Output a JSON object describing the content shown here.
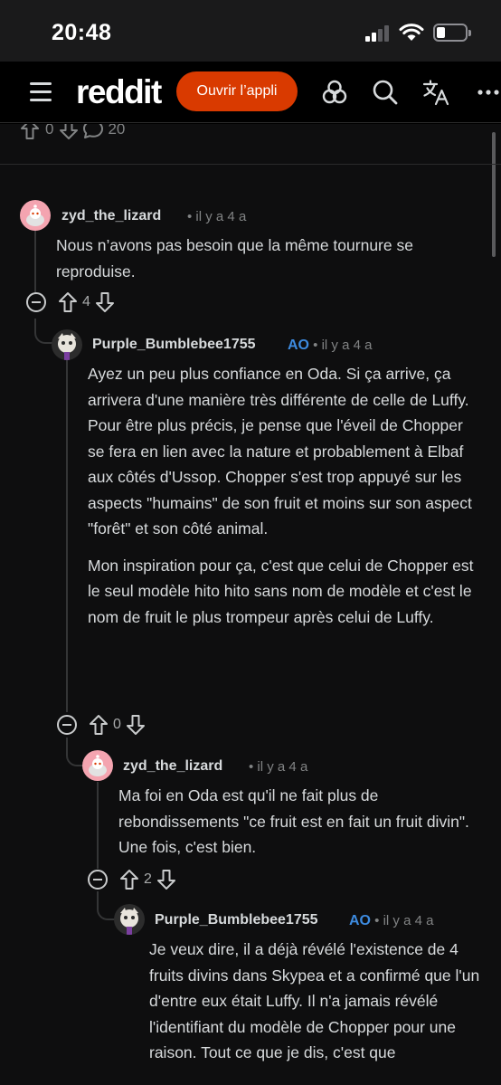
{
  "status": {
    "time": "20:48"
  },
  "header": {
    "logo": "reddit",
    "open_app_label": "Ouvrir l’appli"
  },
  "post_bar": {
    "up_count": "0",
    "comment_count": "20"
  },
  "comments": [
    {
      "author": "zyd_the_lizard",
      "op": "",
      "age": "• il y a 4 a",
      "paragraphs": [
        "Nous n’avons pas besoin que la même tournure se reproduise."
      ],
      "score": "4"
    },
    {
      "author": "Purple_Bumblebee1755",
      "op": "AO",
      "age": "• il y a 4 a",
      "paragraphs": [
        "Ayez un peu plus confiance en Oda. Si ça arrive, ça arrivera d'une manière très différente de celle de Luffy. Pour être plus précis, je pense que l'éveil de Chopper se fera en lien avec la nature et probablement à Elbaf aux côtés d'Ussop. Chopper s'est trop appuyé sur les aspects \"humains\" de son fruit et moins sur son aspect \"forêt\" et son côté animal.",
        "Mon inspiration pour ça, c'est que celui de Chopper est le seul modèle hito hito sans nom de modèle et c'est le nom de fruit le plus trompeur après celui de Luffy."
      ],
      "score": "0"
    },
    {
      "author": "zyd_the_lizard",
      "op": "",
      "age": "• il y a 4 a",
      "paragraphs": [
        "Ma foi en Oda est qu'il ne fait plus de rebondissements \"ce fruit est en fait un fruit divin\". Une fois, c'est bien."
      ],
      "score": "2"
    },
    {
      "author": "Purple_Bumblebee1755",
      "op": "AO",
      "age": "• il y a 4 a",
      "paragraphs": [
        "Je veux dire, il a déjà révélé l'existence de 4 fruits divins dans Skypea et a confirmé que l'un d'entre eux était Luffy. Il n'a jamais révélé l'identifiant du modèle de Chopper pour une raison. Tout ce que je dis, c'est que"
      ]
    }
  ]
}
